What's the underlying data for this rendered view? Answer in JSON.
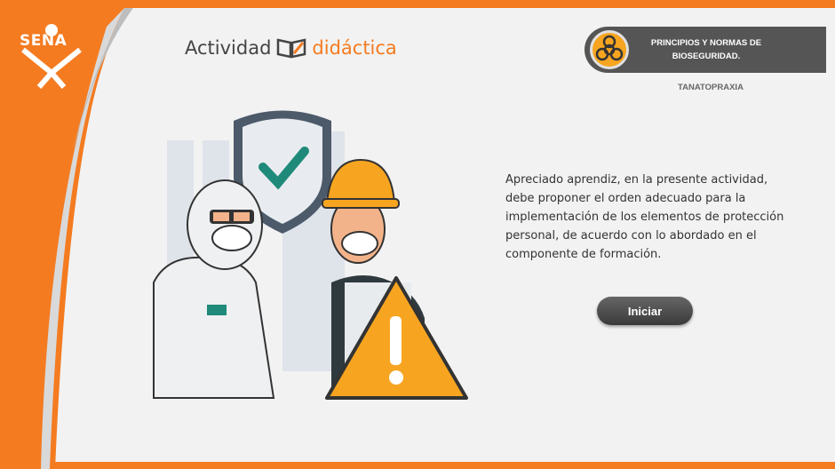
{
  "brand": {
    "logo_text": "SENA",
    "accent_color": "#f47b20"
  },
  "header": {
    "title_part1": "Actividad",
    "title_part2": "didáctica",
    "title_icon": "book-pencil-icon"
  },
  "badge": {
    "icon": "biohazard-icon",
    "title": "PRINCIPIOS Y NORMAS DE BIOSEGURIDAD.",
    "subtitle": "TANATOPRAXIA"
  },
  "illustration": {
    "icons": [
      "shield-check-icon",
      "hazmat-worker",
      "construction-worker",
      "warning-triangle-icon"
    ]
  },
  "main": {
    "description": "Apreciado aprendiz, en la presente actividad, debe proponer el  orden adecuado para la implementación de los elementos de protección personal, de acuerdo con lo abordado en el componente de formación.",
    "start_button": "Iniciar"
  }
}
